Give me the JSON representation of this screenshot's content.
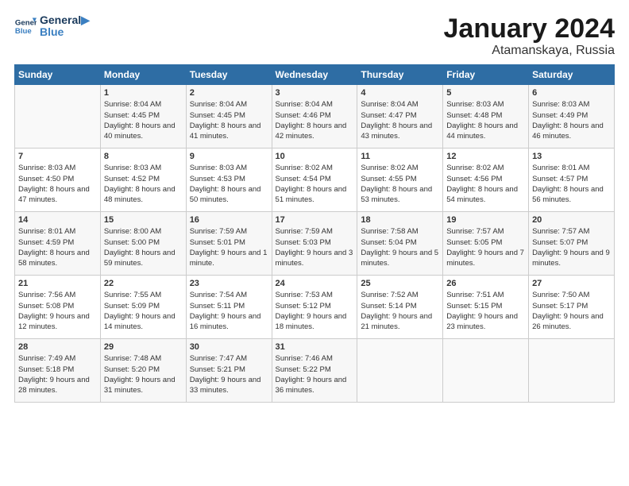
{
  "header": {
    "logo_line1": "General",
    "logo_line2": "Blue",
    "title": "January 2024",
    "subtitle": "Atamanskaya, Russia"
  },
  "weekdays": [
    "Sunday",
    "Monday",
    "Tuesday",
    "Wednesday",
    "Thursday",
    "Friday",
    "Saturday"
  ],
  "weeks": [
    [
      {
        "day": "",
        "sunrise": "",
        "sunset": "",
        "daylight": ""
      },
      {
        "day": "1",
        "sunrise": "Sunrise: 8:04 AM",
        "sunset": "Sunset: 4:45 PM",
        "daylight": "Daylight: 8 hours and 40 minutes."
      },
      {
        "day": "2",
        "sunrise": "Sunrise: 8:04 AM",
        "sunset": "Sunset: 4:45 PM",
        "daylight": "Daylight: 8 hours and 41 minutes."
      },
      {
        "day": "3",
        "sunrise": "Sunrise: 8:04 AM",
        "sunset": "Sunset: 4:46 PM",
        "daylight": "Daylight: 8 hours and 42 minutes."
      },
      {
        "day": "4",
        "sunrise": "Sunrise: 8:04 AM",
        "sunset": "Sunset: 4:47 PM",
        "daylight": "Daylight: 8 hours and 43 minutes."
      },
      {
        "day": "5",
        "sunrise": "Sunrise: 8:03 AM",
        "sunset": "Sunset: 4:48 PM",
        "daylight": "Daylight: 8 hours and 44 minutes."
      },
      {
        "day": "6",
        "sunrise": "Sunrise: 8:03 AM",
        "sunset": "Sunset: 4:49 PM",
        "daylight": "Daylight: 8 hours and 46 minutes."
      }
    ],
    [
      {
        "day": "7",
        "sunrise": "Sunrise: 8:03 AM",
        "sunset": "Sunset: 4:50 PM",
        "daylight": "Daylight: 8 hours and 47 minutes."
      },
      {
        "day": "8",
        "sunrise": "Sunrise: 8:03 AM",
        "sunset": "Sunset: 4:52 PM",
        "daylight": "Daylight: 8 hours and 48 minutes."
      },
      {
        "day": "9",
        "sunrise": "Sunrise: 8:03 AM",
        "sunset": "Sunset: 4:53 PM",
        "daylight": "Daylight: 8 hours and 50 minutes."
      },
      {
        "day": "10",
        "sunrise": "Sunrise: 8:02 AM",
        "sunset": "Sunset: 4:54 PM",
        "daylight": "Daylight: 8 hours and 51 minutes."
      },
      {
        "day": "11",
        "sunrise": "Sunrise: 8:02 AM",
        "sunset": "Sunset: 4:55 PM",
        "daylight": "Daylight: 8 hours and 53 minutes."
      },
      {
        "day": "12",
        "sunrise": "Sunrise: 8:02 AM",
        "sunset": "Sunset: 4:56 PM",
        "daylight": "Daylight: 8 hours and 54 minutes."
      },
      {
        "day": "13",
        "sunrise": "Sunrise: 8:01 AM",
        "sunset": "Sunset: 4:57 PM",
        "daylight": "Daylight: 8 hours and 56 minutes."
      }
    ],
    [
      {
        "day": "14",
        "sunrise": "Sunrise: 8:01 AM",
        "sunset": "Sunset: 4:59 PM",
        "daylight": "Daylight: 8 hours and 58 minutes."
      },
      {
        "day": "15",
        "sunrise": "Sunrise: 8:00 AM",
        "sunset": "Sunset: 5:00 PM",
        "daylight": "Daylight: 8 hours and 59 minutes."
      },
      {
        "day": "16",
        "sunrise": "Sunrise: 7:59 AM",
        "sunset": "Sunset: 5:01 PM",
        "daylight": "Daylight: 9 hours and 1 minute."
      },
      {
        "day": "17",
        "sunrise": "Sunrise: 7:59 AM",
        "sunset": "Sunset: 5:03 PM",
        "daylight": "Daylight: 9 hours and 3 minutes."
      },
      {
        "day": "18",
        "sunrise": "Sunrise: 7:58 AM",
        "sunset": "Sunset: 5:04 PM",
        "daylight": "Daylight: 9 hours and 5 minutes."
      },
      {
        "day": "19",
        "sunrise": "Sunrise: 7:57 AM",
        "sunset": "Sunset: 5:05 PM",
        "daylight": "Daylight: 9 hours and 7 minutes."
      },
      {
        "day": "20",
        "sunrise": "Sunrise: 7:57 AM",
        "sunset": "Sunset: 5:07 PM",
        "daylight": "Daylight: 9 hours and 9 minutes."
      }
    ],
    [
      {
        "day": "21",
        "sunrise": "Sunrise: 7:56 AM",
        "sunset": "Sunset: 5:08 PM",
        "daylight": "Daylight: 9 hours and 12 minutes."
      },
      {
        "day": "22",
        "sunrise": "Sunrise: 7:55 AM",
        "sunset": "Sunset: 5:09 PM",
        "daylight": "Daylight: 9 hours and 14 minutes."
      },
      {
        "day": "23",
        "sunrise": "Sunrise: 7:54 AM",
        "sunset": "Sunset: 5:11 PM",
        "daylight": "Daylight: 9 hours and 16 minutes."
      },
      {
        "day": "24",
        "sunrise": "Sunrise: 7:53 AM",
        "sunset": "Sunset: 5:12 PM",
        "daylight": "Daylight: 9 hours and 18 minutes."
      },
      {
        "day": "25",
        "sunrise": "Sunrise: 7:52 AM",
        "sunset": "Sunset: 5:14 PM",
        "daylight": "Daylight: 9 hours and 21 minutes."
      },
      {
        "day": "26",
        "sunrise": "Sunrise: 7:51 AM",
        "sunset": "Sunset: 5:15 PM",
        "daylight": "Daylight: 9 hours and 23 minutes."
      },
      {
        "day": "27",
        "sunrise": "Sunrise: 7:50 AM",
        "sunset": "Sunset: 5:17 PM",
        "daylight": "Daylight: 9 hours and 26 minutes."
      }
    ],
    [
      {
        "day": "28",
        "sunrise": "Sunrise: 7:49 AM",
        "sunset": "Sunset: 5:18 PM",
        "daylight": "Daylight: 9 hours and 28 minutes."
      },
      {
        "day": "29",
        "sunrise": "Sunrise: 7:48 AM",
        "sunset": "Sunset: 5:20 PM",
        "daylight": "Daylight: 9 hours and 31 minutes."
      },
      {
        "day": "30",
        "sunrise": "Sunrise: 7:47 AM",
        "sunset": "Sunset: 5:21 PM",
        "daylight": "Daylight: 9 hours and 33 minutes."
      },
      {
        "day": "31",
        "sunrise": "Sunrise: 7:46 AM",
        "sunset": "Sunset: 5:22 PM",
        "daylight": "Daylight: 9 hours and 36 minutes."
      },
      {
        "day": "",
        "sunrise": "",
        "sunset": "",
        "daylight": ""
      },
      {
        "day": "",
        "sunrise": "",
        "sunset": "",
        "daylight": ""
      },
      {
        "day": "",
        "sunrise": "",
        "sunset": "",
        "daylight": ""
      }
    ]
  ]
}
